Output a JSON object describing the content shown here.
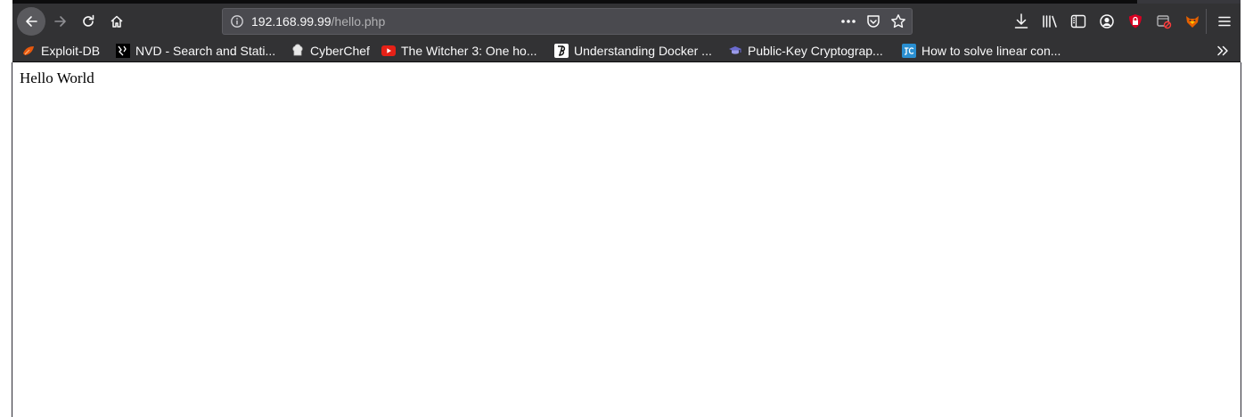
{
  "browser": {
    "url": {
      "host": "192.168.99.99",
      "path": "/hello.php"
    },
    "bookmarks": [
      {
        "label": "Exploit-DB",
        "icon": "exploit-db-icon"
      },
      {
        "label": "NVD - Search and Stati...",
        "icon": "nvd-icon"
      },
      {
        "label": "CyberChef",
        "icon": "cyberchef-icon"
      },
      {
        "label": "The Witcher 3: One ho...",
        "icon": "youtube-icon"
      },
      {
        "label": "Understanding Docker ...",
        "icon": "docker-article-icon"
      },
      {
        "label": "Public-Key Cryptograp...",
        "icon": "cryptography-icon"
      },
      {
        "label": "How to solve linear con...",
        "icon": "linear-con-icon"
      }
    ]
  },
  "page": {
    "body_text": "Hello World"
  },
  "colors": {
    "toolbar": "#323234",
    "url_bar": "#4a4a4f",
    "text_light": "#f9f9fa",
    "youtube_red": "#e62117",
    "ublock_red": "#d70022"
  }
}
